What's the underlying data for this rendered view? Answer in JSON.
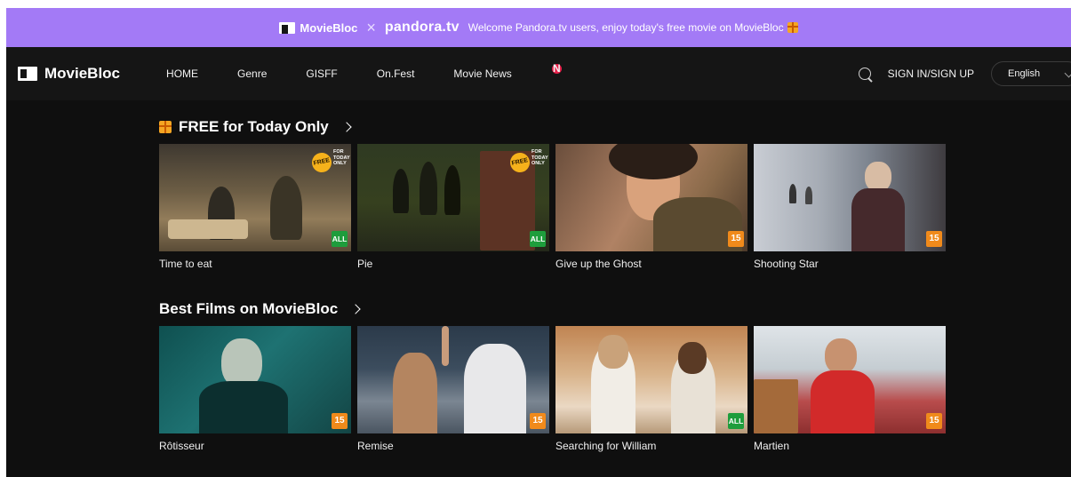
{
  "promo": {
    "brand": "MovieBloc",
    "separator": "×",
    "partner": "pandora.tv",
    "message": "Welcome Pandora.tv users, enjoy today's free movie on MovieBloc"
  },
  "nav": {
    "brand": "MovieBloc",
    "items": [
      {
        "label": "HOME"
      },
      {
        "label": "Genre"
      },
      {
        "label": "GISFF"
      },
      {
        "label": "On.Fest"
      },
      {
        "label": "Movie News",
        "badge": "N"
      }
    ],
    "signin": "SIGN IN/SIGN UP",
    "language": "English"
  },
  "sections": [
    {
      "title": "FREE for Today Only",
      "movies": [
        {
          "title": "Time to eat",
          "rating": "ALL",
          "free": true
        },
        {
          "title": "Pie",
          "rating": "ALL",
          "free": true
        },
        {
          "title": "Give up the Ghost",
          "rating": "15",
          "free": false
        },
        {
          "title": "Shooting Star",
          "rating": "15",
          "free": false
        }
      ]
    },
    {
      "title": "Best Films on MovieBloc",
      "movies": [
        {
          "title": "Rôtisseur",
          "rating": "15"
        },
        {
          "title": "Remise",
          "rating": "15"
        },
        {
          "title": "Searching for William",
          "rating": "ALL"
        },
        {
          "title": "Martien",
          "rating": "15"
        }
      ]
    }
  ],
  "free_badge": {
    "burst": "FREE",
    "text": "FOR TODAY ONLY"
  },
  "colors": {
    "banner": "#a37af6",
    "background": "#0f0f0f",
    "rating_all": "#1e9d3c",
    "rating_15": "#f08a1b",
    "news_badge": "#e7204a"
  },
  "icons": [
    "moviebloc-logo-icon",
    "gift-icon",
    "search-icon",
    "chevron-down-icon",
    "chevron-right-icon"
  ]
}
